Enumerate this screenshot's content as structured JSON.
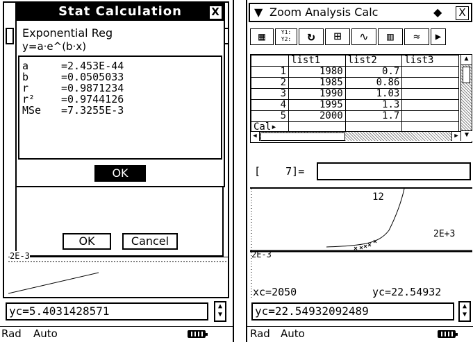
{
  "left": {
    "dialog": {
      "title": "Stat Calculation",
      "close_glyph": "X",
      "reg_type": "Exponential Reg",
      "formula": "y=a·e^(b·x)",
      "results": [
        {
          "name": "a",
          "value": "=2.453E-44"
        },
        {
          "name": "b",
          "value": "=0.0505033"
        },
        {
          "name": "r",
          "value": "=0.9871234"
        },
        {
          "name": "r²",
          "value": "=0.9744126"
        },
        {
          "name": "MSe",
          "value": "=7.3255E-3"
        }
      ],
      "ok_label": "OK"
    },
    "back_dialog": {
      "ok_label": "OK",
      "cancel_label": "Cancel"
    },
    "graph_label": "2E-3",
    "input_value": "yc=5.4031428571",
    "status": {
      "mode": "Rad",
      "format": "Auto"
    }
  },
  "right": {
    "menu_arrow": "▼",
    "title": "Zoom Analysis Calc",
    "diamond": "◆",
    "close_glyph": "X",
    "toolbar": [
      {
        "icon": "grid-view-icon",
        "glyph": "▦"
      },
      {
        "icon": "y-equals-icon",
        "glyph": "Y1: Y2:"
      },
      {
        "icon": "refresh-icon",
        "glyph": "↻"
      },
      {
        "icon": "zoom-box-icon",
        "glyph": "⊞"
      },
      {
        "icon": "graph-regression-icon",
        "glyph": "∿"
      },
      {
        "icon": "stat-window-icon",
        "glyph": "▥"
      },
      {
        "icon": "trace-icon",
        "glyph": "≈"
      },
      {
        "icon": "more-arrow-icon",
        "glyph": "▶"
      }
    ],
    "list": {
      "headers": [
        "",
        "list1",
        "list2",
        "list3"
      ],
      "rows": [
        [
          "1",
          "1980",
          "0.7",
          ""
        ],
        [
          "2",
          "1985",
          "0.86",
          ""
        ],
        [
          "3",
          "1990",
          "1.03",
          ""
        ],
        [
          "4",
          "1995",
          "1.3",
          ""
        ],
        [
          "5",
          "2000",
          "1.7",
          ""
        ]
      ],
      "footer": "Cal▸"
    },
    "cell_ref": "[    7]=",
    "graph": {
      "top_label": "12",
      "right_label": "2E+3",
      "left_label": "2E-3",
      "xc": "xc=2050",
      "yc": "yc=22.54932"
    },
    "input_value": "yc=22.54932092489",
    "status": {
      "mode": "Rad",
      "format": "Auto"
    }
  }
}
